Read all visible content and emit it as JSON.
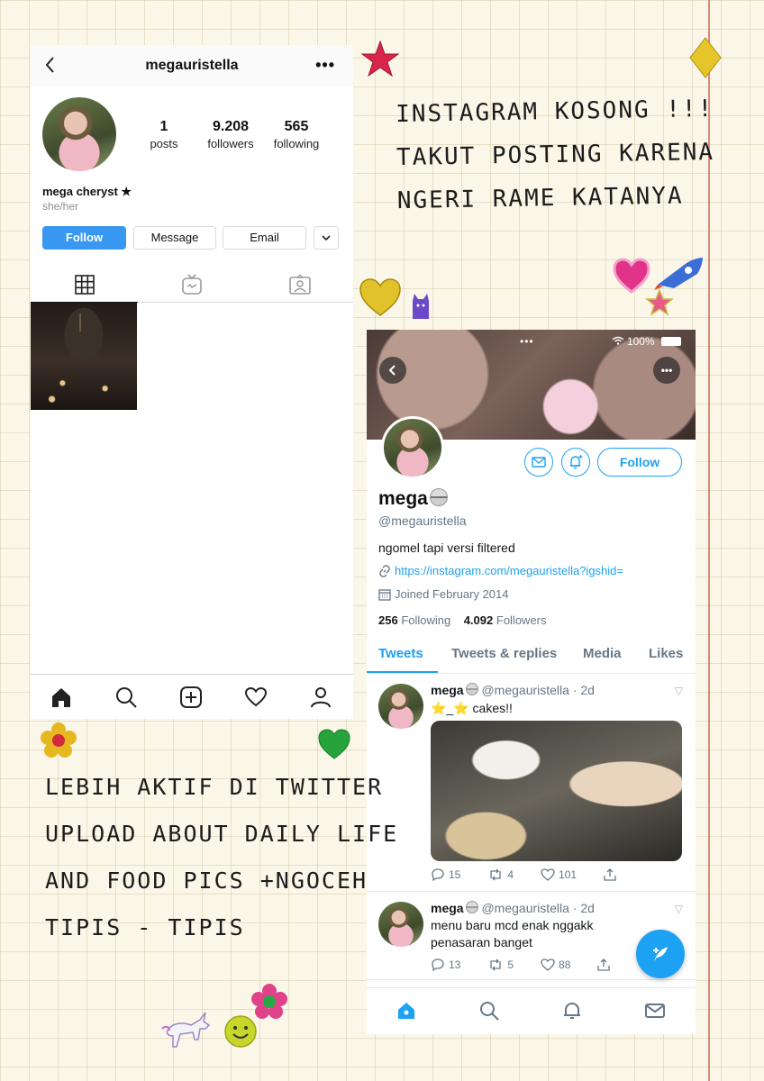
{
  "instagram": {
    "username": "megauristella",
    "more_icon": "•••",
    "stats": [
      {
        "num": "1",
        "label": "posts"
      },
      {
        "num": "9.208",
        "label": "followers"
      },
      {
        "num": "565",
        "label": "following"
      }
    ],
    "display_name": "mega cheryst ★",
    "pronouns": "she/her",
    "buttons": {
      "follow": "Follow",
      "message": "Message",
      "email": "Email"
    },
    "tabs": [
      "grid-icon",
      "igtv-icon",
      "tagged-icon"
    ],
    "nav": [
      "home-icon",
      "search-icon",
      "add-icon",
      "heart-icon",
      "profile-icon"
    ]
  },
  "twitter": {
    "status": {
      "battery": "100%",
      "dots": "•••"
    },
    "more_label": "•••",
    "follow_label": "Follow",
    "name": "mega",
    "handle": "@megauristella",
    "bio": "ngomel tapi versi filtered",
    "link": "https://instagram.com/megauristella?igshid=",
    "joined": "Joined February 2014",
    "following_count": "256",
    "following_label": "Following",
    "followers_count": "4.092",
    "followers_label": "Followers",
    "tabs": [
      "Tweets",
      "Tweets & replies",
      "Media",
      "Likes"
    ],
    "tweets": [
      {
        "name": "mega",
        "meta": "@megauristella · 2d",
        "text": "⭐️_⭐️ cakes!!",
        "replies": "15",
        "retweets": "4",
        "likes": "101"
      },
      {
        "name": "mega",
        "meta": "@megauristella · 2d",
        "text": "menu baru mcd enak nggakk penasaran banget",
        "replies": "13",
        "retweets": "5",
        "likes": "88"
      }
    ],
    "nav": [
      "home-icon",
      "search-icon",
      "notifications-icon",
      "messages-icon"
    ]
  },
  "captions": {
    "top": [
      "instagram kosong !!!",
      "takut posting karena",
      "ngeri rame katanya"
    ],
    "bottom": [
      "lebih aktif di twitter",
      "upload about daily life",
      "and food pics +ngoceh",
      "tipis - tipis"
    ]
  },
  "colors": {
    "instagram_blue": "#3897f0",
    "twitter_blue": "#1da1f2",
    "paper": "#fbf7e8"
  }
}
